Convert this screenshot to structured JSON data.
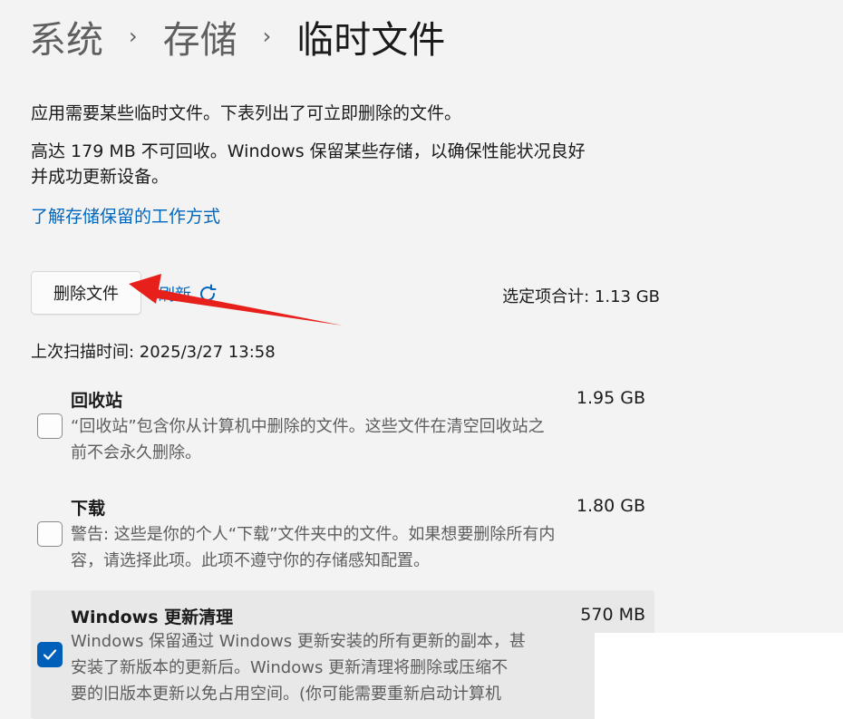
{
  "breadcrumb": {
    "item1": "系统",
    "item2": "存储",
    "current": "临时文件",
    "separator": "›"
  },
  "intro": {
    "line1": "应用需要某些临时文件。下表列出了可立即删除的文件。",
    "line2": "高达 179 MB 不可回收。Windows 保留某些存储，以确保性能状况良好",
    "line3": "并成功更新设备。",
    "link": "了解存储保留的工作方式"
  },
  "actions": {
    "delete_label": "删除文件",
    "refresh_label": "刷新",
    "selected_total": "选定项合计: 1.13 GB",
    "last_scan": "上次扫描时间: 2025/3/27 13:58"
  },
  "items": [
    {
      "title": "回收站",
      "size": "1.95 GB",
      "checked": false,
      "desc1": "“回收站”包含你从计算机中删除的文件。这些文件在清空回收站之",
      "desc2": "前不会永久删除。"
    },
    {
      "title": "下载",
      "size": "1.80 GB",
      "checked": false,
      "desc1": "警告: 这些是你的个人“下载”文件夹中的文件。如果想要删除所有内",
      "desc2": "容，请选择此项。此项不遵守你的存储感知配置。"
    },
    {
      "title": "Windows 更新清理",
      "size": "570 MB",
      "checked": true,
      "desc1": "Windows 保留通过 Windows 更新安装的所有更新的副本，甚",
      "desc2": "安装了新版本的更新后。Windows 更新清理将删除或压缩不",
      "desc3": "要的旧版本更新以免占用空间。(你可能需要重新启动计算机"
    }
  ],
  "colors": {
    "accent": "#005fb8",
    "link": "#0067c0",
    "annotation_arrow": "#e8201c"
  }
}
